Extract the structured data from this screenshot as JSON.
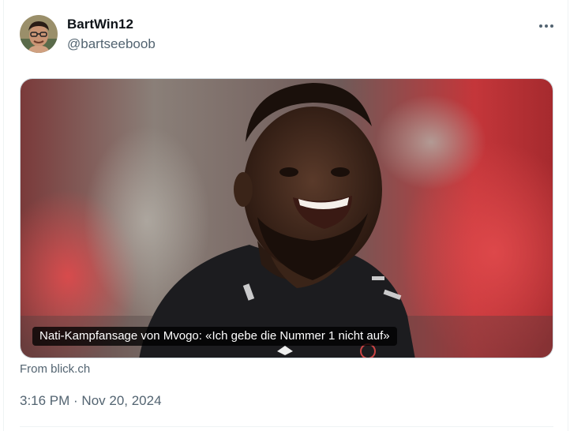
{
  "author": {
    "display_name": "BartWin12",
    "handle": "@bartseeboob"
  },
  "menu": {
    "more_icon": "more-horizontal-icon"
  },
  "link_card": {
    "headline": "Nati-Kampfansage von Mvogo: «Ich gebe die Nummer 1 nicht auf»",
    "source": "From blick.ch"
  },
  "meta": {
    "timestamp": "3:16 PM · Nov 20, 2024"
  },
  "colors": {
    "text_primary": "#0f1419",
    "text_secondary": "#536471",
    "border": "#cfd9de"
  }
}
